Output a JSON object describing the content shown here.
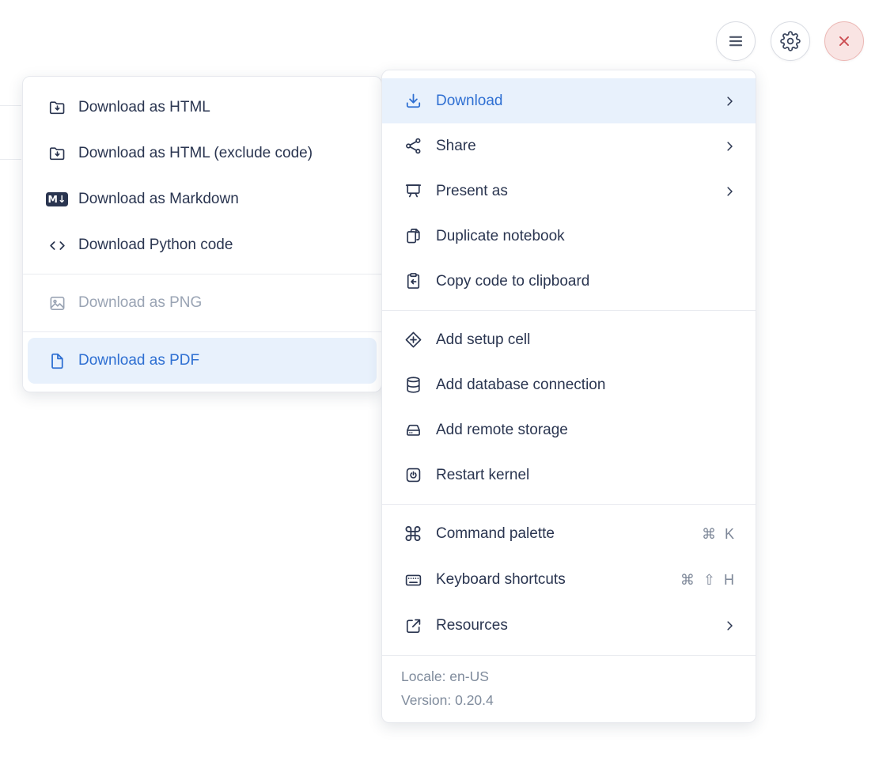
{
  "toolbar": {
    "buttons": [
      {
        "id": "menu",
        "icon": "hamburger-icon"
      },
      {
        "id": "settings",
        "icon": "gear-icon"
      },
      {
        "id": "close",
        "icon": "close-icon"
      }
    ]
  },
  "download_submenu": {
    "groups": [
      {
        "items": [
          {
            "label": "Download as HTML",
            "icon": "folder-download-icon"
          },
          {
            "label": "Download as HTML (exclude code)",
            "icon": "folder-download-icon"
          },
          {
            "label": "Download as Markdown",
            "icon": "markdown-icon",
            "icon_text": "M↓"
          },
          {
            "label": "Download Python code",
            "icon": "code-icon"
          }
        ]
      },
      {
        "items": [
          {
            "label": "Download as PNG",
            "icon": "image-icon",
            "state": "disabled"
          }
        ]
      },
      {
        "items": [
          {
            "label": "Download as PDF",
            "icon": "file-icon",
            "state": "highlighted"
          }
        ]
      }
    ]
  },
  "main_menu": {
    "groups": [
      {
        "items": [
          {
            "label": "Download",
            "icon": "download-icon",
            "has_submenu": true,
            "state": "active"
          },
          {
            "label": "Share",
            "icon": "share-icon",
            "has_submenu": true
          },
          {
            "label": "Present as",
            "icon": "presentation-icon",
            "has_submenu": true
          },
          {
            "label": "Duplicate notebook",
            "icon": "duplicate-icon"
          },
          {
            "label": "Copy code to clipboard",
            "icon": "clipboard-copy-icon"
          }
        ]
      },
      {
        "items": [
          {
            "label": "Add setup cell",
            "icon": "diamond-plus-icon"
          },
          {
            "label": "Add database connection",
            "icon": "database-icon"
          },
          {
            "label": "Add remote storage",
            "icon": "storage-drive-icon"
          },
          {
            "label": "Restart kernel",
            "icon": "power-icon"
          }
        ]
      },
      {
        "items": [
          {
            "label": "Command palette",
            "icon": "command-icon",
            "shortcut": "⌘ K"
          },
          {
            "label": "Keyboard shortcuts",
            "icon": "keyboard-icon",
            "shortcut": "⌘ ⇧ H"
          },
          {
            "label": "Resources",
            "icon": "external-link-icon",
            "has_submenu": true
          }
        ]
      }
    ],
    "footer": {
      "locale": "Locale: en-US",
      "version": "Version: 0.20.4"
    }
  },
  "colors": {
    "accent_blue": "#2e6fd2",
    "highlight_bg": "#e8f1fc",
    "text_dark": "#2a3550",
    "muted_gray": "#7d8798",
    "disabled_gray": "#9aa4b4",
    "divider": "#e9ebf0",
    "close_red": "#cb4b50",
    "close_bg": "#f9e4e3",
    "close_border": "#ecb7b4"
  }
}
